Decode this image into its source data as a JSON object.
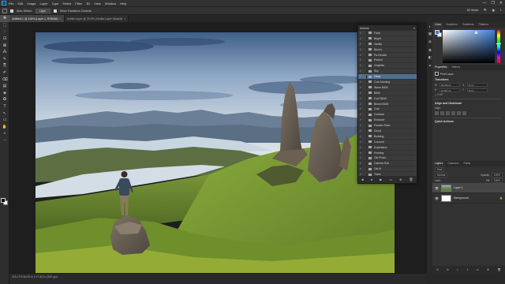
{
  "app": {
    "logo": "Ps"
  },
  "menu": [
    "File",
    "Edit",
    "Image",
    "Layer",
    "Type",
    "Select",
    "Filter",
    "3D",
    "View",
    "Window",
    "Help"
  ],
  "window_controls": {
    "minimize": "—",
    "maximize": "❐",
    "close": "✕"
  },
  "options_bar": {
    "auto_select_label": "Auto-Select:",
    "auto_select_value": "Layer",
    "transform_label": "Show Transform Controls",
    "more": "···",
    "right_icons": [
      "3D Mode:",
      "🔍",
      "▣",
      "⇪"
    ]
  },
  "tools": [
    "✥",
    "⬚",
    "◌",
    "⊡",
    "⊠",
    "⁂",
    "✎",
    "⎘",
    "✐",
    "⌫",
    "▤",
    "◈",
    "✪",
    "T",
    "↖",
    "▭",
    "✋",
    "⌕",
    "···"
  ],
  "document_tabs": [
    {
      "label": "Untitled-1 @ 116% (Layer 1, RGB/8#)",
      "active": true
    },
    {
      "label": "Untitle Layer @ 25.6% (Vanilla Layer Mask/8)",
      "active": false
    }
  ],
  "status": {
    "text": "116.17%    5d.25 in x 27.82 in (300 ppi)"
  },
  "actions_panel": {
    "title": "Actions",
    "menu": "≡",
    "items": [
      {
        "label": "Fade",
        "selected": false
      },
      {
        "label": "Bright",
        "selected": false
      },
      {
        "label": "Vanilla",
        "selected": false
      },
      {
        "label": "Bloom",
        "selected": false
      },
      {
        "label": "Pa-Render",
        "selected": false
      },
      {
        "label": "Peanut",
        "selected": false
      },
      {
        "label": "Graphite",
        "selected": false
      },
      {
        "label": "Sky",
        "selected": false
      },
      {
        "label": "Clear",
        "selected": true
      },
      {
        "label": "Cool Morning",
        "selected": false
      },
      {
        "label": "Warm B&W",
        "selected": false
      },
      {
        "label": "B&W",
        "selected": false
      },
      {
        "label": "Cool B&W",
        "selected": false
      },
      {
        "label": "Brown B&W",
        "selected": false
      },
      {
        "label": "Cool",
        "selected": false
      },
      {
        "label": "Contrast",
        "selected": false
      },
      {
        "label": "Enhance",
        "selected": false
      },
      {
        "label": "Powder Rose",
        "selected": false
      },
      {
        "label": "Cloud",
        "selected": false
      },
      {
        "label": "Budding",
        "selected": false
      },
      {
        "label": "Coconut",
        "selected": false
      },
      {
        "label": "Expressive",
        "selected": false
      },
      {
        "label": "Evening",
        "selected": false
      },
      {
        "label": "Old Photo",
        "selected": false
      },
      {
        "label": "Camera Roll",
        "selected": false
      },
      {
        "label": "Old tit",
        "selected": false
      },
      {
        "label": "Trans",
        "selected": false
      }
    ],
    "footer_icons": [
      "■",
      "●",
      "▶",
      "▭",
      "⊕",
      "🗑"
    ]
  },
  "color_panel": {
    "tabs": [
      "Color",
      "Swatches",
      "Gradients",
      "Patterns"
    ],
    "foreground": "#3d7fd8",
    "background": "#ffffff"
  },
  "properties_panel": {
    "tabs": [
      "Properties",
      "History"
    ],
    "layer_label": "Pixel Layer",
    "transform_title": "Transform",
    "w_label": "W",
    "w_value": "91.28 cm",
    "x_label": "X",
    "x_value": "0 cm",
    "h_label": "H",
    "h_value": "27.82 cm",
    "y_label": "Y",
    "y_value": "0 cm",
    "angle_label": "△ 0.00°",
    "align_title": "Align and Distribute",
    "align_sub": "Align:",
    "quick_actions_title": "Quick Actions"
  },
  "layers_panel": {
    "tabs": [
      "Layers",
      "Channels",
      "Paths"
    ],
    "kind_label": "Kind",
    "blend_mode": "Normal",
    "opacity_label": "Opacity:",
    "opacity_value": "100%",
    "lock_label": "Lock:",
    "fill_label": "Fill:",
    "fill_value": "100%",
    "layers": [
      {
        "name": "Layer 1",
        "selected": true
      },
      {
        "name": "Background",
        "selected": false
      }
    ],
    "lock_icon": "🔒",
    "footer_icons": [
      "⊖",
      "fx",
      "◐",
      "◑",
      "▭",
      "⊕",
      "🗑"
    ]
  },
  "icon_strip": [
    "◐",
    "▦",
    "◍",
    "⧉",
    "◧",
    "⌗"
  ]
}
